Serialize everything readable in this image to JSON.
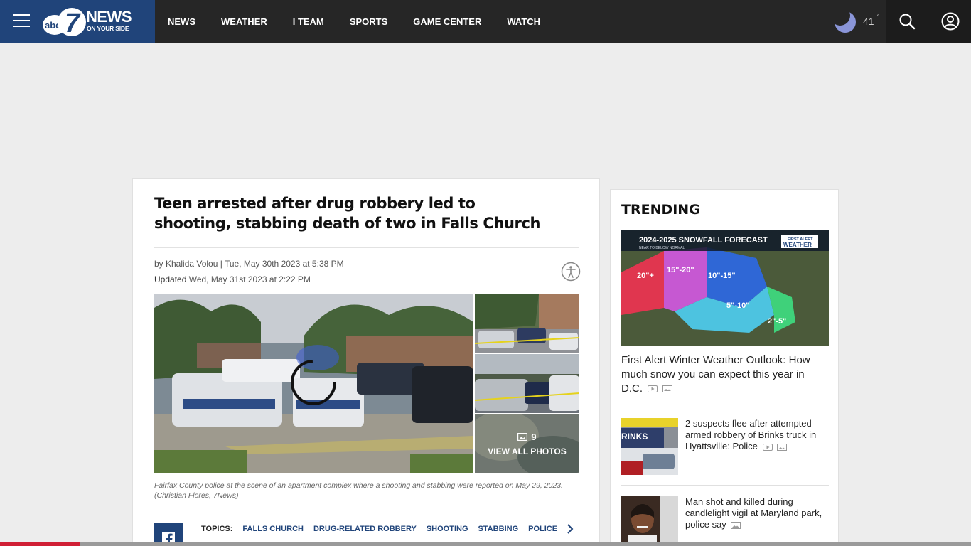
{
  "header": {
    "logo_news": "NEWS",
    "logo_sub": "ON YOUR SIDE",
    "logo_abc": "abc",
    "logo_num": "7",
    "nav": [
      "NEWS",
      "WEATHER",
      "I TEAM",
      "SPORTS",
      "GAME CENTER",
      "WATCH"
    ],
    "temperature": "41",
    "degree": "°",
    "weather_icon": "moon-icon"
  },
  "article": {
    "title": "Teen arrested after drug robbery led to shooting, stabbing death of two in Falls Church",
    "byline": "by Khalida Volou | Tue, May 30th 2023 at 5:38 PM",
    "updated_label": "Updated",
    "updated_value": "Wed, May 31st 2023 at 2:22 PM",
    "photo_count": "9",
    "view_all": "VIEW ALL PHOTOS",
    "caption": "Fairfax County police at the scene of an apartment complex where a shooting and stabbing were reported on May 29, 2023. (Christian Flores, 7News)",
    "topics_label": "TOPICS:",
    "topics": [
      "FALLS CHURCH",
      "DRUG-RELATED ROBBERY",
      "SHOOTING",
      "STABBING",
      "POLICE"
    ]
  },
  "trending": {
    "heading": "TRENDING",
    "featured": {
      "title": "First Alert Winter Weather Outlook: How much snow you can expect this year in D.C.",
      "map_title": "2024-2025 SNOWFALL FORECAST",
      "map_sub": "NEAR TO BELOW NORMAL",
      "map_badge_top": "FIRST ALERT",
      "map_badge_bottom": "WEATHER",
      "zones": [
        "20\"+",
        "15\"-20\"",
        "10\"-15\"",
        "5\"-10\"",
        "2\"-5\""
      ]
    },
    "items": [
      {
        "title": "2 suspects flee after attempted armed robbery of Brinks truck in Hyattsville: Police",
        "thumb_text": "RINKS"
      },
      {
        "title": "Man shot and killed during candlelight vigil at Maryland park, police say"
      }
    ]
  },
  "reading_progress": 0.082,
  "colors": {
    "brand_blue": "#20447a",
    "header_bg": "#262626",
    "accent_red": "#d01f35"
  }
}
